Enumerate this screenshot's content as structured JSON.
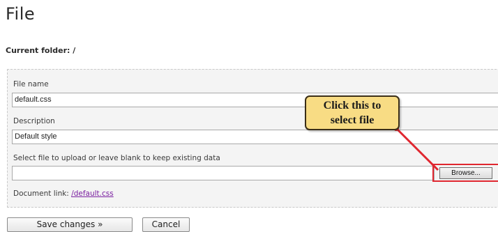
{
  "page": {
    "title": "File",
    "current_folder": "Current folder: /"
  },
  "form": {
    "file_name_label": "File name",
    "file_name_value": "default.css",
    "description_label": "Description",
    "description_value": "Default style",
    "upload_label": "Select file to upload or leave blank to keep existing data",
    "upload_value": "",
    "browse_label": "Browse...",
    "document_link_label": "Document link:",
    "document_link_text": "/default.css"
  },
  "callout": {
    "line1": "Click this to",
    "line2": "select file"
  },
  "actions": {
    "save_label": "Save changes »",
    "cancel_label": "Cancel"
  },
  "colors": {
    "callout_fill": "#f8dc84",
    "annotation_red": "#e0262f",
    "link_color": "#7a1fa0"
  }
}
